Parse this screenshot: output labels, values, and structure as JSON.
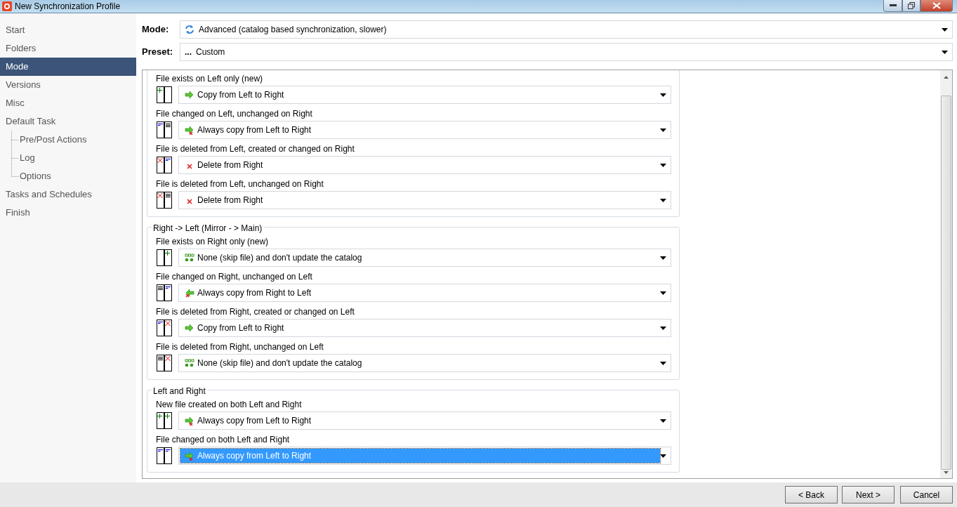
{
  "window": {
    "title": "New Synchronization Profile"
  },
  "sidebar": {
    "items": [
      {
        "label": "Start",
        "selected": false
      },
      {
        "label": "Folders",
        "selected": false
      },
      {
        "label": "Mode",
        "selected": true
      },
      {
        "label": "Versions",
        "selected": false
      },
      {
        "label": "Misc",
        "selected": false
      },
      {
        "label": "Default Task",
        "selected": false,
        "children": [
          {
            "label": "Pre/Post Actions",
            "selected": false
          },
          {
            "label": "Log",
            "selected": false
          },
          {
            "label": "Options",
            "selected": false
          }
        ]
      },
      {
        "label": "Tasks and Schedules",
        "selected": false
      },
      {
        "label": "Finish",
        "selected": false
      }
    ]
  },
  "mode": {
    "label": "Mode:",
    "value": "Advanced (catalog based synchronization, slower)"
  },
  "preset": {
    "label": "Preset:",
    "icon_text": "...",
    "value": "Custom"
  },
  "groups": [
    {
      "rules": [
        {
          "label": "File exists on Left only (new)",
          "file_states": [
            {
              "kind": "new"
            },
            {
              "kind": "empty"
            }
          ],
          "action": {
            "kind": "copy_lr",
            "text": "Copy from Left to Right"
          },
          "focused": false
        },
        {
          "label": "File changed on Left, unchanged on Right",
          "file_states": [
            {
              "kind": "changed"
            },
            {
              "kind": "unchanged"
            }
          ],
          "action": {
            "kind": "always_lr",
            "text": "Always copy from Left to Right"
          },
          "focused": false
        },
        {
          "label": "File is deleted from Left, created or changed on Right",
          "file_states": [
            {
              "kind": "deleted"
            },
            {
              "kind": "changed"
            }
          ],
          "action": {
            "kind": "delete",
            "text": "Delete from Right"
          },
          "focused": false
        },
        {
          "label": "File is deleted from Left, unchanged on Right",
          "file_states": [
            {
              "kind": "deleted"
            },
            {
              "kind": "unchanged"
            }
          ],
          "action": {
            "kind": "delete",
            "text": "Delete from Right"
          },
          "focused": false
        }
      ]
    },
    {
      "title": "Right -> Left (Mirror - > Main)",
      "rules": [
        {
          "label": "File exists on Right only (new)",
          "file_states": [
            {
              "kind": "empty"
            },
            {
              "kind": "new"
            }
          ],
          "action": {
            "kind": "none",
            "text": "None (skip file) and don't update the catalog"
          },
          "focused": false
        },
        {
          "label": "File changed on Right, unchanged on Left",
          "file_states": [
            {
              "kind": "unchanged"
            },
            {
              "kind": "changed"
            }
          ],
          "action": {
            "kind": "always_rl",
            "text": "Always copy from Right to Left"
          },
          "focused": false
        },
        {
          "label": "File is deleted from Right, created or changed on Left",
          "file_states": [
            {
              "kind": "changed"
            },
            {
              "kind": "deleted"
            }
          ],
          "action": {
            "kind": "copy_lr",
            "text": "Copy from Left to Right"
          },
          "focused": false
        },
        {
          "label": "File is deleted from Right, unchanged on Left",
          "file_states": [
            {
              "kind": "unchanged"
            },
            {
              "kind": "deleted"
            }
          ],
          "action": {
            "kind": "none",
            "text": "None (skip file) and don't update the catalog"
          },
          "focused": false
        }
      ]
    },
    {
      "title": "Left and Right",
      "rules": [
        {
          "label": "New file created on both Left and Right",
          "file_states": [
            {
              "kind": "new"
            },
            {
              "kind": "new"
            }
          ],
          "action": {
            "kind": "always_lr",
            "text": "Always copy from Left to Right"
          },
          "focused": false
        },
        {
          "label": "File changed on both Left and Right",
          "file_states": [
            {
              "kind": "changed"
            },
            {
              "kind": "changed"
            }
          ],
          "action": {
            "kind": "always_lr",
            "text": "Always copy from Left to Right"
          },
          "focused": true
        }
      ]
    }
  ],
  "buttons": [
    "< Back",
    "Next >",
    "Cancel"
  ]
}
